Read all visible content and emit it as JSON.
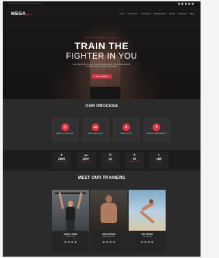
{
  "topbar": {
    "info": "Mon - Sat: 9:00 - 19:00  |  info@megafitness.com"
  },
  "brand": {
    "name": "MEGA",
    "suffix": "gym",
    "accent_color": "#e8354a"
  },
  "nav": {
    "items": [
      "Home",
      "Our Process",
      "Our Trainers",
      "Member Plans",
      "Pricing",
      "Contact Us",
      "Blog"
    ]
  },
  "hero": {
    "eyebrow": "BE STRONG, BE A FIGHTER",
    "title_line1": "TRAIN THE",
    "title_line2": "FIGHTER IN YOU",
    "lead": "Lorem ipsum dolor sit amet, consectetur adipiscing elit, sed do eiusmod tempor incididunt ut labore et dolore magna aliqua.",
    "cta": "GET STARTED"
  },
  "process": {
    "title": "OUR PROCESS",
    "steps": [
      {
        "label": "ANALYZE YOUR GOAL",
        "icon": "target-icon"
      },
      {
        "label": "WORK HARD ON IT",
        "icon": "dumbbell-icon"
      },
      {
        "label": "IMPROVE FITS",
        "icon": "chart-icon"
      },
      {
        "label": "ACHIEVE YOUR PERFECT",
        "icon": "trophy-icon"
      }
    ]
  },
  "stats": [
    {
      "value": "2550",
      "label": "HAPPY CLIENTS",
      "icon": "user-icon"
    },
    {
      "value": "320+",
      "label": "TOTAL GYMS",
      "icon": "dumbbell-icon"
    },
    {
      "value": "44",
      "label": "TRAINERS",
      "icon": "medal-icon"
    },
    {
      "value": "30",
      "label": "AWARDS WON",
      "icon": "award-icon"
    },
    {
      "value": "188",
      "label": "CLASSES",
      "icon": "fire-icon"
    }
  ],
  "trainers": {
    "title": "MEET OUR TRAINERS",
    "people": [
      {
        "name": "JESSICA JONES",
        "role": "Fitness Trainer"
      },
      {
        "name": "MARK STRONG",
        "role": "Bodybuilding Coach"
      },
      {
        "name": "LISA PARKER",
        "role": "Yoga Instructor"
      }
    ]
  }
}
